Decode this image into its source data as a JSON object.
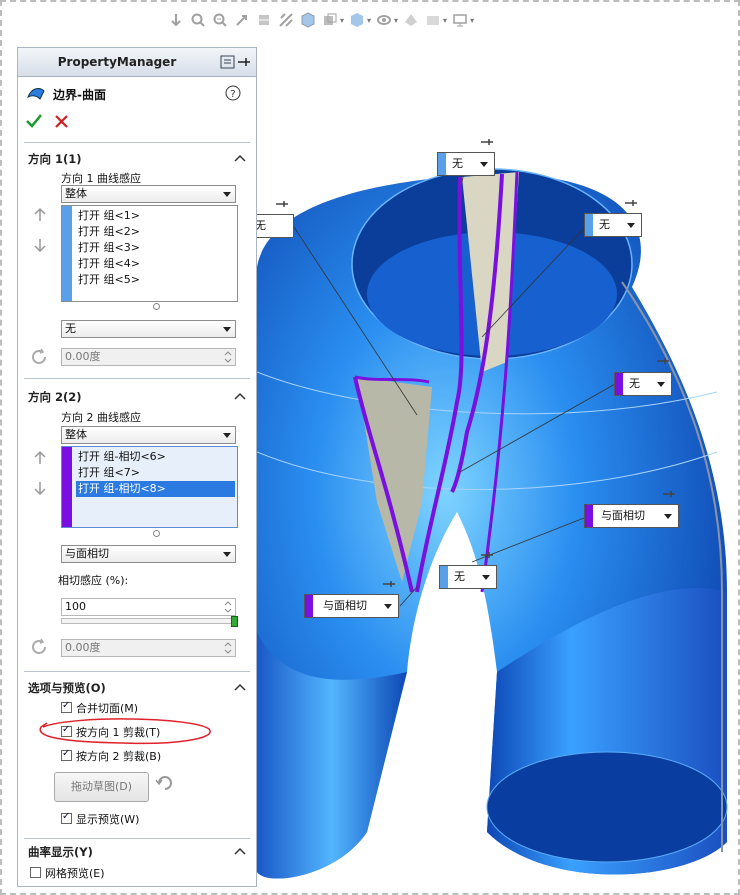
{
  "property_manager": {
    "title": "PropertyManager",
    "feature_title": "边界-曲面"
  },
  "direction1": {
    "title": "方向 1(1)",
    "curve_influence_label": "方向 1 曲线感应",
    "curve_influence_value": "整体",
    "items": [
      "打开 组<1>",
      "打开 组<2>",
      "打开 组<3>",
      "打开 组<4>",
      "打开 组<5>"
    ],
    "tangency_value": "无",
    "angle_value": "0.00度"
  },
  "direction2": {
    "title": "方向 2(2)",
    "curve_influence_label": "方向 2 曲线感应",
    "curve_influence_value": "整体",
    "items": [
      "打开 组-相切<6>",
      "打开 组<7>",
      "打开 组-相切<8>"
    ],
    "selected_index": 2,
    "tangency_value": "与面相切",
    "tangent_influence_label": "相切感应 (%):",
    "tangent_influence_value": "100",
    "angle_value": "0.00度"
  },
  "options": {
    "title": "选项与预览(O)",
    "merge_tangent_faces": "合并切面(M)",
    "trim_by_dir1": "按方向 1 剪裁(T)",
    "trim_by_dir2": "按方向 2 剪裁(B)",
    "drag_sketch": "拖动草图(D)",
    "show_preview": "显示预览(W)"
  },
  "curvature": {
    "title": "曲率显示(Y)",
    "mesh_preview": "网格预览(E)"
  },
  "callouts": {
    "top": "无",
    "left": "无",
    "right_top": "无",
    "right_mid": "无",
    "right_tangent": "与面相切",
    "center_low": "无",
    "left_tangent": "与面相切"
  },
  "colors": {
    "dir1": "#5aa0e8",
    "dir2": "#7a10e0",
    "model_blue": "#1f6fd6",
    "annotation_red": "#e0202a"
  }
}
